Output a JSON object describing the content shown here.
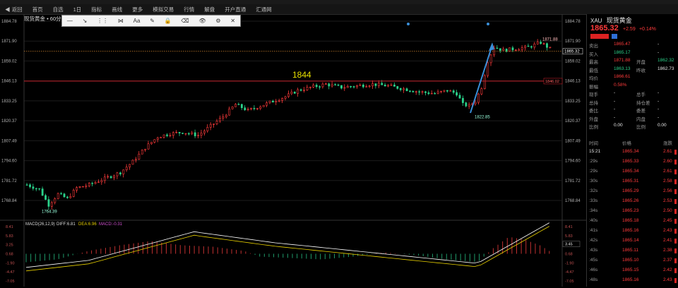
{
  "toolbar": {
    "items": [
      "◀ 返回",
      "首页",
      "自选",
      "1日",
      "指标",
      "画线",
      "更多",
      "模拟交易",
      "行情",
      "解盘",
      "开户直通",
      "汇通网"
    ]
  },
  "chart": {
    "title": "现货黄金 • 60分",
    "draw_tools": [
      "—",
      "↘",
      "⋮⋮",
      "⋈",
      "Aa",
      "✎",
      "🔒",
      "⌫",
      "👁",
      "⚙",
      "✕"
    ],
    "y_labels": [
      "1884.78",
      "1871.90",
      "1859.02",
      "1846.13",
      "1833.25",
      "1820.37",
      "1807.49",
      "1794.60",
      "1781.72",
      "1768.84"
    ],
    "right_y_labels": [
      "1884.78",
      "1871.90",
      "1859.02",
      "1846.13",
      "1833.25",
      "1820.37",
      "1807.49",
      "1794.60",
      "1781.72",
      "1768.84"
    ],
    "current_price_tag": "1865.32",
    "hline_price_tag": "1846.02",
    "annotation_1844": "1844",
    "low_label": "1764.39",
    "high_label": "1871.88",
    "dip_label": "1822.85",
    "macd_legend": {
      "name": "MACD(26,12,9)",
      "diff": "DIFF:6.81",
      "dea": "DEA:6.96",
      "macd": "MACD:-0.31"
    },
    "macd_y_labels": [
      "8.41",
      "5.83",
      "3.25",
      "0.68",
      "-1.90",
      "-4.47",
      "-7.05"
    ],
    "macd_right_labels": [
      "8.41",
      "5.83",
      "3.25",
      "0.68",
      "-1.90",
      "-4.47",
      "-7.05"
    ],
    "macd_mid_tag": "3.45",
    "colors": {
      "up": "#ff3b3b",
      "down": "#2bd38b",
      "hline": "#c0202a",
      "arrow": "#3a8fd8",
      "diff": "#ffffff",
      "dea": "#e8d000"
    }
  },
  "panel": {
    "code": "XAU",
    "name": "现货黄金",
    "price": "1865.32",
    "change": "+2.59",
    "change_pct": "+0.14%",
    "fields": [
      {
        "l": "卖出",
        "v": "1865.47",
        "l2": "",
        "v2": "-"
      },
      {
        "l": "买入",
        "v": "1865.17",
        "l2": "",
        "v2": "-"
      },
      {
        "l": "最高",
        "v": "1871.88",
        "l2": "开盘",
        "v2": "1862.32"
      },
      {
        "l": "最低",
        "v": "1863.13",
        "l2": "昨收",
        "v2": "1862.73"
      },
      {
        "l": "均价",
        "v": "1866.61",
        "l2": "",
        "v2": ""
      },
      {
        "l": "振幅",
        "v": "0.58%",
        "l2": "",
        "v2": ""
      },
      {
        "l": "现手",
        "v": "-",
        "l2": "总手",
        "v2": "-"
      },
      {
        "l": "总持",
        "v": "-",
        "l2": "持仓差",
        "v2": "-"
      },
      {
        "l": "委比",
        "v": "-",
        "l2": "委差",
        "v2": "-"
      },
      {
        "l": "外盘",
        "v": "-",
        "l2": "内盘",
        "v2": "-"
      },
      {
        "l": "比例",
        "v": "0.00",
        "l2": "比例",
        "v2": "0.00"
      }
    ],
    "trade_headers": [
      "时间",
      "价格",
      "涨跌"
    ],
    "trades": [
      {
        "t": "15:21",
        "p": "1865.34",
        "c": "2.61"
      },
      {
        "t": ":29s",
        "p": "1865.33",
        "c": "2.60"
      },
      {
        "t": ":29s",
        "p": "1865.34",
        "c": "2.61"
      },
      {
        "t": ":30s",
        "p": "1865.31",
        "c": "2.58"
      },
      {
        "t": ":32s",
        "p": "1865.29",
        "c": "2.56"
      },
      {
        "t": ":33s",
        "p": "1865.26",
        "c": "2.53"
      },
      {
        "t": ":34s",
        "p": "1865.23",
        "c": "2.50"
      },
      {
        "t": ":40s",
        "p": "1865.18",
        "c": "2.45"
      },
      {
        "t": ":41s",
        "p": "1865.16",
        "c": "2.43"
      },
      {
        "t": ":42s",
        "p": "1865.14",
        "c": "2.41"
      },
      {
        "t": ":43s",
        "p": "1865.11",
        "c": "2.38"
      },
      {
        "t": ":45s",
        "p": "1865.10",
        "c": "2.37"
      },
      {
        "t": ":46s",
        "p": "1865.15",
        "c": "2.42"
      },
      {
        "t": ":48s",
        "p": "1865.16",
        "c": "2.43"
      }
    ]
  }
}
